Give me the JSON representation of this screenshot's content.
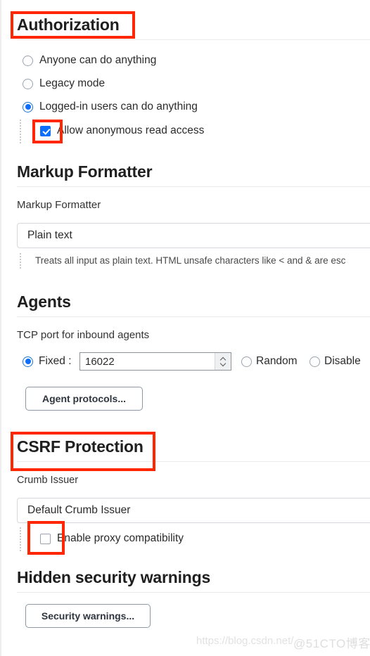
{
  "sections": {
    "authorization": {
      "heading": "Authorization",
      "options": [
        {
          "label": "Anyone can do anything",
          "selected": false
        },
        {
          "label": "Legacy mode",
          "selected": false
        },
        {
          "label": "Logged-in users can do anything",
          "selected": true
        }
      ],
      "nested_checkbox": {
        "label": "Allow anonymous read access",
        "checked": true
      }
    },
    "markup_formatter": {
      "heading": "Markup Formatter",
      "field_label": "Markup Formatter",
      "selected_value": "Plain text",
      "help_text": "Treats all input as plain text. HTML unsafe characters like < and & are esc"
    },
    "agents": {
      "heading": "Agents",
      "field_label": "TCP port for inbound agents",
      "fixed_label": "Fixed :",
      "fixed_selected": true,
      "port_value": "16022",
      "random_label": "Random",
      "random_selected": false,
      "disable_label": "Disable",
      "disable_selected": false,
      "protocols_button": "Agent protocols..."
    },
    "csrf": {
      "heading": "CSRF Protection",
      "field_label": "Crumb Issuer",
      "selected_value": "Default Crumb Issuer",
      "nested_checkbox": {
        "label": "Enable proxy compatibility",
        "checked": false
      }
    },
    "hidden_warnings": {
      "heading": "Hidden security warnings",
      "button": "Security warnings..."
    }
  },
  "annotations": {
    "color": "#ff2600",
    "targets": [
      "authorization-heading",
      "allow-anonymous-read-access-checkbox",
      "csrf-protection-heading",
      "enable-proxy-compatibility-checkbox"
    ]
  },
  "watermark": {
    "url": "https://blog.csdn.net/",
    "handle": "@51CTO博客"
  }
}
